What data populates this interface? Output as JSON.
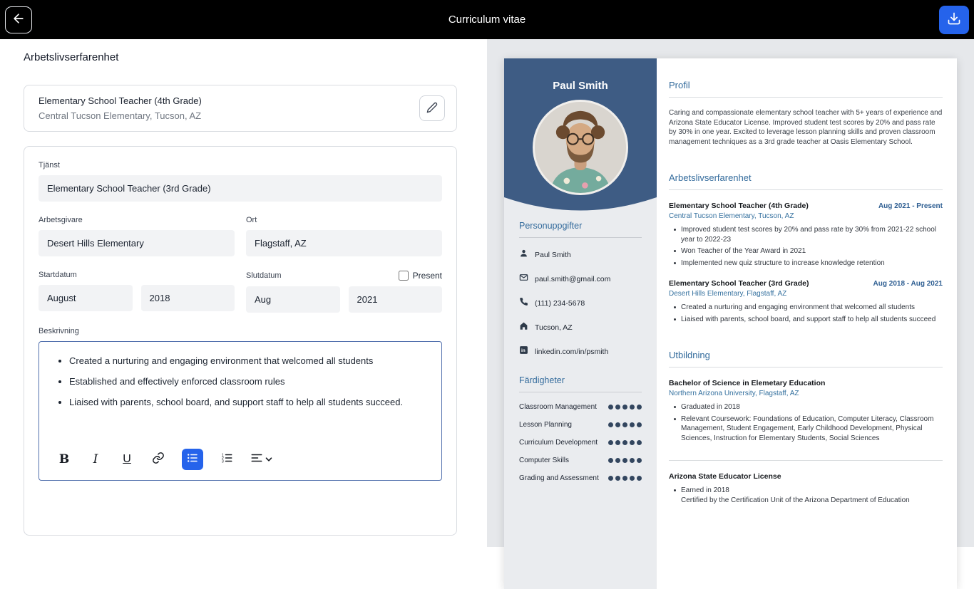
{
  "topbar": {
    "title": "Curriculum vitae"
  },
  "colors": {
    "accent_blue": "#2563eb",
    "cv_header_blue": "#3e5c84",
    "cv_heading_blue": "#336b9c",
    "skill_dot": "#33465f",
    "focus_border": "#5270ad"
  },
  "editor": {
    "section_title": "Arbetslivserfarenhet",
    "entry_card": {
      "title": "Elementary School Teacher (4th Grade)",
      "subtitle": "Central Tucson Elementary, Tucson, AZ"
    },
    "form": {
      "tjanst": {
        "label": "Tjänst",
        "value": "Elementary School Teacher (3rd Grade)"
      },
      "arbetsgivare": {
        "label": "Arbetsgivare",
        "value": "Desert Hills Elementary"
      },
      "ort": {
        "label": "Ort",
        "value": "Flagstaff, AZ"
      },
      "startdatum": {
        "label": "Startdatum",
        "month": "August",
        "year": "2018"
      },
      "slutdatum": {
        "label": "Slutdatum",
        "month": "Aug",
        "year": "2021"
      },
      "present_label": "Present",
      "beskrivning_label": "Beskrivning",
      "description_bullets": [
        "Created a nurturing and engaging environment that welcomed all students",
        "Established and effectively enforced classroom rules",
        "Liaised with parents, school board, and support staff to help all students succeed."
      ]
    },
    "toolbar": {
      "bold": "B",
      "italic": "I",
      "underline": "U"
    }
  },
  "preview": {
    "name": "Paul Smith",
    "sidebar": {
      "personal_heading": "Personuppgifter",
      "contacts": [
        {
          "icon": "person-icon",
          "text": "Paul Smith"
        },
        {
          "icon": "mail-icon",
          "text": "paul.smith@gmail.com"
        },
        {
          "icon": "phone-icon",
          "text": "(111) 234-5678"
        },
        {
          "icon": "home-icon",
          "text": "Tucson, AZ"
        },
        {
          "icon": "linkedin-icon",
          "text": "linkedin.com/in/psmith"
        }
      ],
      "skills_heading": "Färdigheter",
      "skills": [
        {
          "name": "Classroom Management",
          "level": 5
        },
        {
          "name": "Lesson Planning",
          "level": 5
        },
        {
          "name": "Curriculum Development",
          "level": 5
        },
        {
          "name": "Computer Skills",
          "level": 5
        },
        {
          "name": "Grading and Assessment",
          "level": 5
        }
      ]
    },
    "main": {
      "profile_heading": "Profil",
      "profile_text": "Caring and compassionate elementary school teacher with 5+ years of experience and Arizona State Educator License. Improved student test scores by 20% and pass rate by 30% in one year. Excited to leverage lesson planning skills and proven classroom management techniques as a 3rd grade teacher at Oasis Elementary School.",
      "experience_heading": "Arbetslivserfarenhet",
      "experience": [
        {
          "title": "Elementary School Teacher (4th Grade)",
          "dates": "Aug 2021 - Present",
          "company": "Central Tucson Elementary, Tucson, AZ",
          "bullets": [
            "Improved student test scores by 20% and pass rate by 30% from 2021-22 school year to 2022-23",
            "Won Teacher of the Year Award in 2021",
            "Implemented new quiz structure to increase knowledge retention"
          ]
        },
        {
          "title": "Elementary School Teacher (3rd Grade)",
          "dates": "Aug 2018 - Aug 2021",
          "company": "Desert Hills Elementary, Flagstaff, AZ",
          "bullets": [
            "Created a nurturing and engaging environment that welcomed all students",
            "Liaised with parents, school board, and support staff to help all students succeed"
          ]
        }
      ],
      "education_heading": "Utbildning",
      "education": [
        {
          "title": "Bachelor of Science in Elemetary Education",
          "school": "Northern Arizona University, Flagstaff, AZ",
          "bullets": [
            "Graduated in 2018",
            "Relevant Coursework: Foundations of Education, Computer Literacy, Classroom Management, Student Engagement, Early Childhood Development, Physical Sciences, Instruction for Elementary Students, Social Sciences"
          ]
        },
        {
          "title": "Arizona State Educator License",
          "bullets": [
            "Earned in 2018\nCertified by the Certification Unit of the Arizona Department of Education"
          ]
        }
      ]
    }
  }
}
